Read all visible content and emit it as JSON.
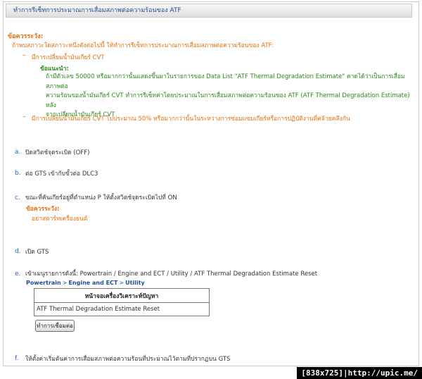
{
  "header": {
    "title": "ทำการรีเซ็ทการประมาณการเสื่อมสภาพต่อความร้อนของ ATF"
  },
  "caution": {
    "title": "ข้อควรระวัง:",
    "intro": "ถ้าพบสภาวะใดสภาวะหนึ่งดังต่อไปนี้ ให้ทำการรีเซ็ทการประมาณการเสื่อมสภาพต่อความร้อนของ ATF:",
    "bullets": [
      "มีการเปลี่ยนน้ำมันเกียร์ CVT",
      "มีการเปลี่ยนน้ำมันเกียร์ CVT ไปประมาณ 50% หรือมากกว่านั้นในระหว่างการซ่อมแซมเกียร์หรือการปฏิบัติงานที่คล้ายคลึงกัน"
    ],
    "advice_title": "ข้อแนะนำ:",
    "advice_lines": [
      "ถ้ามีตัวเลข 50000 หรือมากกว่านั้นแสดงขึ้นมาในรายการของ Data List \"ATF Thermal Degradation Estimate\" คาดได้ว่าเป็นการเสื่อมสภาพต่อ",
      "ความร้อนของน้ำมันเกียร์ CVT ทำการรีเซ็ทค่าโดยประมาณในการเสื่อมสภาพต่อความร้อนของ ATF (ATF Thermal Degradation Estimate) หลัง",
      "จากเปลี่ยนน้ำมันเกียร์ CVT"
    ]
  },
  "steps": {
    "a": {
      "letter": "a.",
      "text": "ปิดสวิตช์จุดระเบิด (OFF)"
    },
    "b": {
      "letter": "b.",
      "text": "ต่อ GTS เข้ากับขั้วต่อ DLC3"
    },
    "c": {
      "letter": "c.",
      "text": "ขณะที่คันเกียร์อยู่ที่ตำแหน่ง P ให้ตั้งสวิตช์จุดระเบิดไปที่ ON",
      "caution_title": "ข้อควรระวัง:",
      "caution_text": "อย่าสตาร์ทเครื่องยนต์"
    },
    "d": {
      "letter": "d.",
      "text": "เปิด GTS"
    },
    "e": {
      "letter": "e.",
      "text": "เข้าเมนูรายการดังนี้: Powertrain / Engine and ECT / Utility / ATF Thermal Degradation Estimate Reset",
      "breadcrumb": [
        "Powertrain",
        "Engine and ECT",
        "Utility"
      ],
      "breadcrumb_sep": ">",
      "table_header": "หน้าจอเครื่องวิเคราะห์ปัญหา",
      "table_cell": "ATF Thermal Degradation Estimate Reset",
      "button_label": "ทำการเชื่อมต่อ"
    },
    "f": {
      "letter": "f.",
      "text": "ให้ตั้งค่าเริ่มต้นค่าการเสื่อมสภาพต่อความร้อนที่ประมาณไว้ตามที่ปรากฏบน GTS"
    }
  },
  "watermark": "[838x725]|http://upic.me/"
}
